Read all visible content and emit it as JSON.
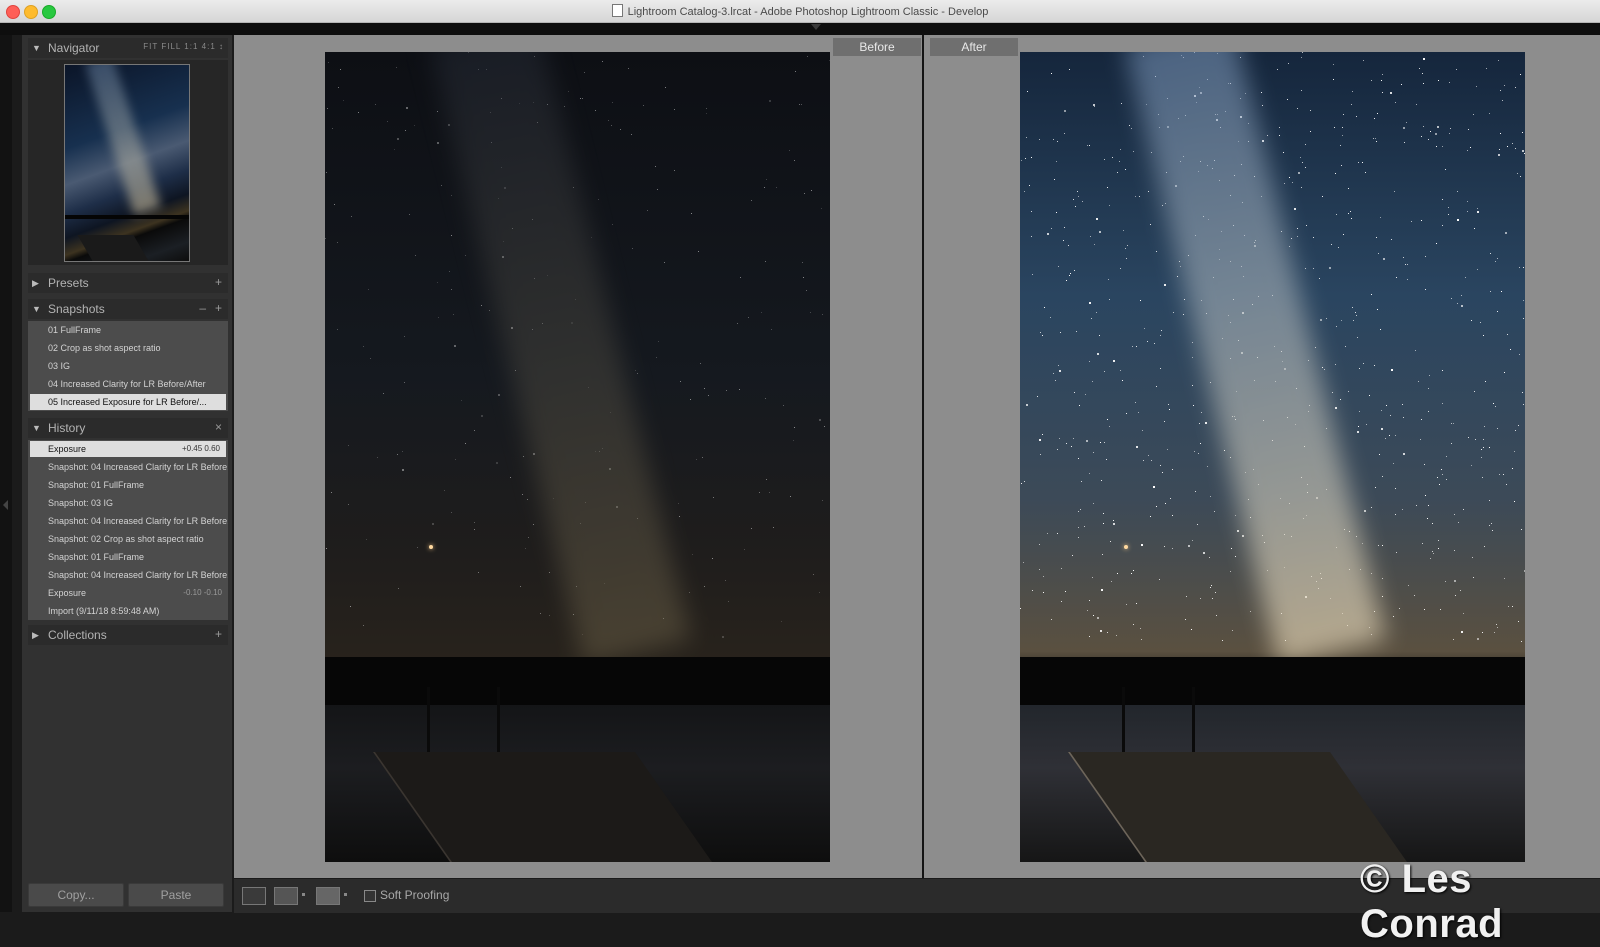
{
  "window": {
    "title": "Lightroom Catalog-3.lrcat - Adobe Photoshop Lightroom Classic - Develop"
  },
  "navigator": {
    "title": "Navigator",
    "zoom_options": "FIT  FILL  1:1  4:1 ↕"
  },
  "presets": {
    "title": "Presets",
    "add": "+"
  },
  "snapshots": {
    "title": "Snapshots",
    "remove": "–",
    "add": "+",
    "items": [
      "01 FullFrame",
      "02 Crop as shot aspect ratio",
      "03 IG",
      "04 Increased Clarity for LR Before/After",
      "05 Increased Exposure for LR Before/..."
    ],
    "selected_index": 4
  },
  "history": {
    "title": "History",
    "clear": "×",
    "items": [
      {
        "label": "Exposure",
        "value": "+0.45   0.60"
      },
      {
        "label": "Snapshot: 04 Increased Clarity for LR Before...",
        "value": ""
      },
      {
        "label": "Snapshot: 01 FullFrame",
        "value": ""
      },
      {
        "label": "Snapshot: 03 IG",
        "value": ""
      },
      {
        "label": "Snapshot: 04 Increased Clarity for LR Before...",
        "value": ""
      },
      {
        "label": "Snapshot: 02 Crop as shot aspect ratio",
        "value": ""
      },
      {
        "label": "Snapshot: 01 FullFrame",
        "value": ""
      },
      {
        "label": "Snapshot: 04 Increased Clarity for LR Before...",
        "value": ""
      },
      {
        "label": "Exposure",
        "value": "-0.10   -0.10"
      },
      {
        "label": "Import (9/11/18 8:59:48 AM)",
        "value": ""
      }
    ],
    "selected_index": 0
  },
  "collections": {
    "title": "Collections",
    "add": "+"
  },
  "buttons": {
    "copy": "Copy...",
    "paste": "Paste"
  },
  "compare": {
    "before_label": "Before",
    "after_label": "After"
  },
  "toolbar": {
    "soft_proofing": "Soft Proofing"
  },
  "watermark": "© Les Conrad",
  "colors": {
    "panel": "#313131",
    "canvas": "#8d8d8d",
    "selected_row": "#dedede"
  }
}
